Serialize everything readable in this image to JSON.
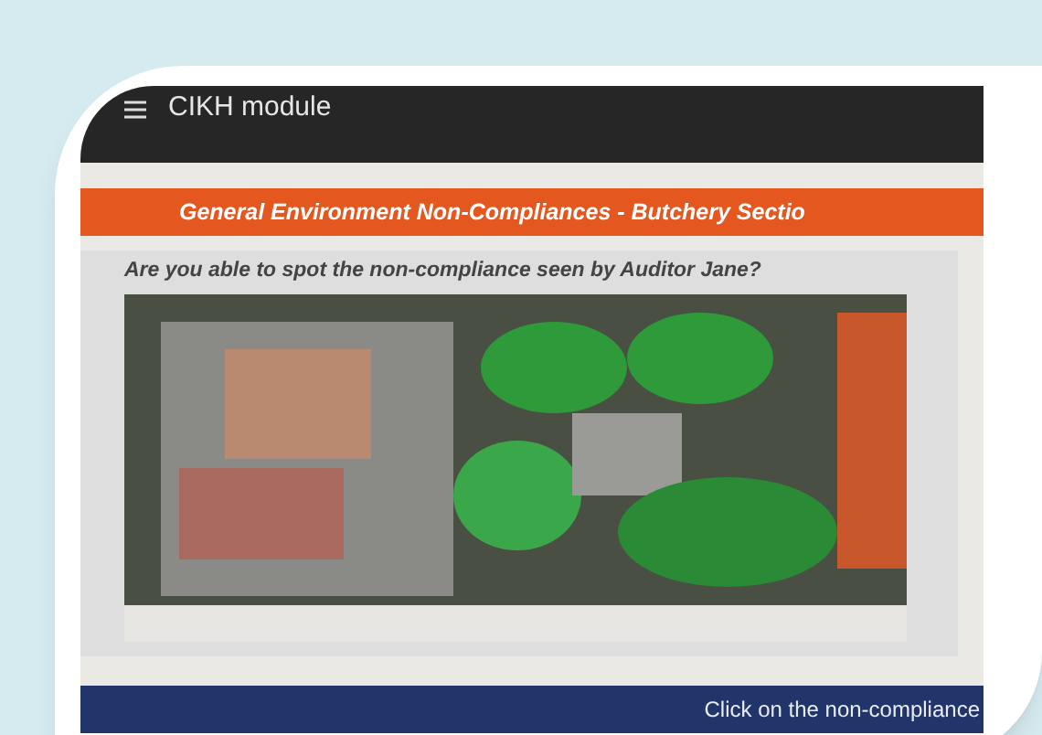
{
  "header": {
    "title": "CIKH module"
  },
  "section_banner": {
    "title": "General Environment Non-Compliances - Butchery Sectio"
  },
  "question": {
    "text": "Are you able to spot the non-compliance seen by Auditor Jane?"
  },
  "footer_bar": {
    "text": "Click on the non-compliance"
  }
}
